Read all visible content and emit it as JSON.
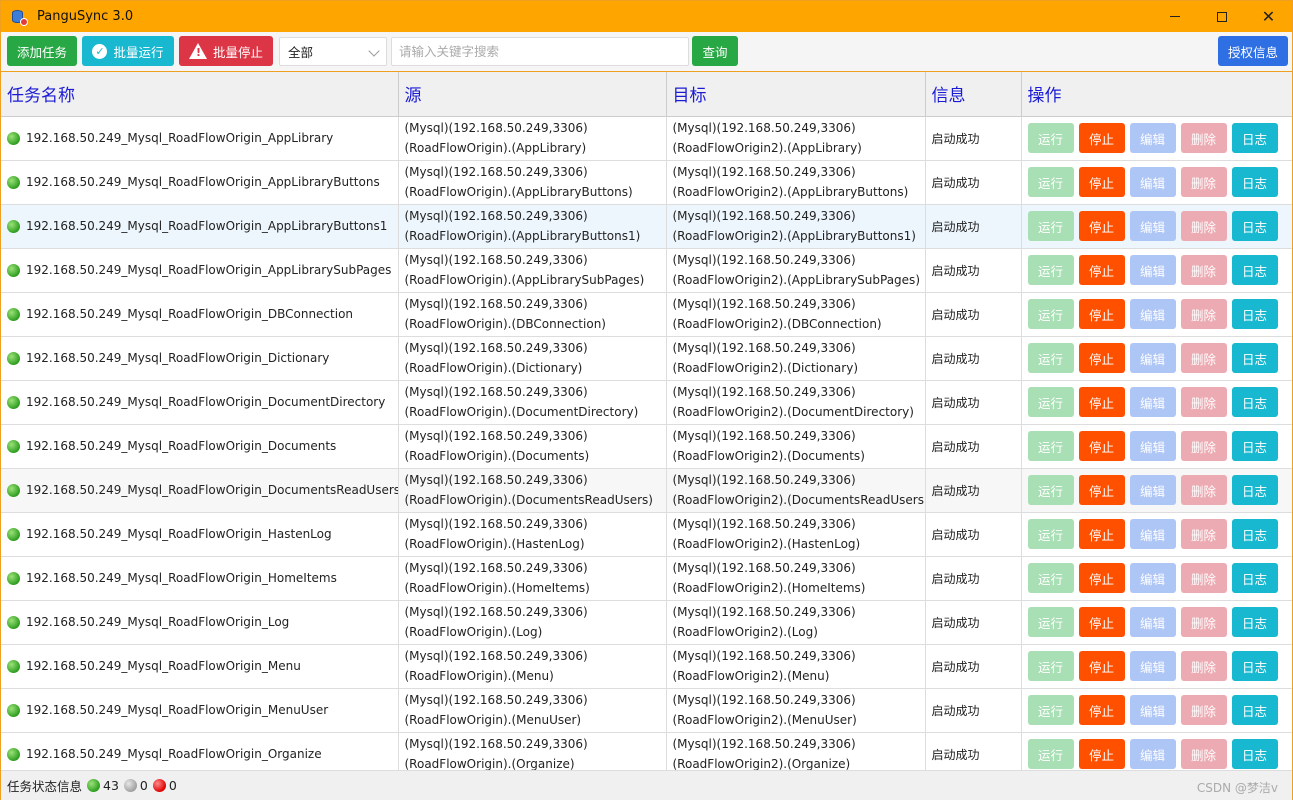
{
  "window": {
    "title": "PanguSync 3.0",
    "controls": {
      "minimize": "—",
      "maximize": "☐",
      "close": "✕"
    }
  },
  "toolbar": {
    "add_task": "添加任务",
    "batch_run": "批量运行",
    "batch_stop": "批量停止",
    "filter_value": "全部",
    "search_placeholder": "请输入关键字搜索",
    "query": "查询",
    "license": "授权信息"
  },
  "table": {
    "headers": {
      "name": "任务名称",
      "source": "源",
      "target": "目标",
      "info": "信息",
      "ops": "操作"
    },
    "op_labels": {
      "run": "运行",
      "stop": "停止",
      "edit": "编辑",
      "delete": "删除",
      "log": "日志"
    },
    "rows": [
      {
        "name": "192.168.50.249_Mysql_RoadFlowOrigin_AppLibrary",
        "src1": "(Mysql)(192.168.50.249,3306)",
        "src2": "(RoadFlowOrigin).(AppLibrary)",
        "dst1": "(Mysql)(192.168.50.249,3306)",
        "dst2": "(RoadFlowOrigin2).(AppLibrary)",
        "info": "启动成功"
      },
      {
        "name": "192.168.50.249_Mysql_RoadFlowOrigin_AppLibraryButtons",
        "src1": "(Mysql)(192.168.50.249,3306)",
        "src2": "(RoadFlowOrigin).(AppLibraryButtons)",
        "dst1": "(Mysql)(192.168.50.249,3306)",
        "dst2": "(RoadFlowOrigin2).(AppLibraryButtons)",
        "info": "启动成功"
      },
      {
        "name": "192.168.50.249_Mysql_RoadFlowOrigin_AppLibraryButtons1",
        "src1": "(Mysql)(192.168.50.249,3306)",
        "src2": "(RoadFlowOrigin).(AppLibraryButtons1)",
        "dst1": "(Mysql)(192.168.50.249,3306)",
        "dst2": "(RoadFlowOrigin2).(AppLibraryButtons1)",
        "info": "启动成功"
      },
      {
        "name": "192.168.50.249_Mysql_RoadFlowOrigin_AppLibrarySubPages",
        "src1": "(Mysql)(192.168.50.249,3306)",
        "src2": "(RoadFlowOrigin).(AppLibrarySubPages)",
        "dst1": "(Mysql)(192.168.50.249,3306)",
        "dst2": "(RoadFlowOrigin2).(AppLibrarySubPages)",
        "info": "启动成功"
      },
      {
        "name": "192.168.50.249_Mysql_RoadFlowOrigin_DBConnection",
        "src1": "(Mysql)(192.168.50.249,3306)",
        "src2": "(RoadFlowOrigin).(DBConnection)",
        "dst1": "(Mysql)(192.168.50.249,3306)",
        "dst2": "(RoadFlowOrigin2).(DBConnection)",
        "info": "启动成功"
      },
      {
        "name": "192.168.50.249_Mysql_RoadFlowOrigin_Dictionary",
        "src1": "(Mysql)(192.168.50.249,3306)",
        "src2": "(RoadFlowOrigin).(Dictionary)",
        "dst1": "(Mysql)(192.168.50.249,3306)",
        "dst2": "(RoadFlowOrigin2).(Dictionary)",
        "info": "启动成功"
      },
      {
        "name": "192.168.50.249_Mysql_RoadFlowOrigin_DocumentDirectory",
        "src1": "(Mysql)(192.168.50.249,3306)",
        "src2": "(RoadFlowOrigin).(DocumentDirectory)",
        "dst1": "(Mysql)(192.168.50.249,3306)",
        "dst2": "(RoadFlowOrigin2).(DocumentDirectory)",
        "info": "启动成功"
      },
      {
        "name": "192.168.50.249_Mysql_RoadFlowOrigin_Documents",
        "src1": "(Mysql)(192.168.50.249,3306)",
        "src2": "(RoadFlowOrigin).(Documents)",
        "dst1": "(Mysql)(192.168.50.249,3306)",
        "dst2": "(RoadFlowOrigin2).(Documents)",
        "info": "启动成功"
      },
      {
        "name": "192.168.50.249_Mysql_RoadFlowOrigin_DocumentsReadUsers",
        "src1": "(Mysql)(192.168.50.249,3306)",
        "src2": "(RoadFlowOrigin).(DocumentsReadUsers)",
        "dst1": "(Mysql)(192.168.50.249,3306)",
        "dst2": "(RoadFlowOrigin2).(DocumentsReadUsers)",
        "info": "启动成功"
      },
      {
        "name": "192.168.50.249_Mysql_RoadFlowOrigin_HastenLog",
        "src1": "(Mysql)(192.168.50.249,3306)",
        "src2": "(RoadFlowOrigin).(HastenLog)",
        "dst1": "(Mysql)(192.168.50.249,3306)",
        "dst2": "(RoadFlowOrigin2).(HastenLog)",
        "info": "启动成功"
      },
      {
        "name": "192.168.50.249_Mysql_RoadFlowOrigin_HomeItems",
        "src1": "(Mysql)(192.168.50.249,3306)",
        "src2": "(RoadFlowOrigin).(HomeItems)",
        "dst1": "(Mysql)(192.168.50.249,3306)",
        "dst2": "(RoadFlowOrigin2).(HomeItems)",
        "info": "启动成功"
      },
      {
        "name": "192.168.50.249_Mysql_RoadFlowOrigin_Log",
        "src1": "(Mysql)(192.168.50.249,3306)",
        "src2": "(RoadFlowOrigin).(Log)",
        "dst1": "(Mysql)(192.168.50.249,3306)",
        "dst2": "(RoadFlowOrigin2).(Log)",
        "info": "启动成功"
      },
      {
        "name": "192.168.50.249_Mysql_RoadFlowOrigin_Menu",
        "src1": "(Mysql)(192.168.50.249,3306)",
        "src2": "(RoadFlowOrigin).(Menu)",
        "dst1": "(Mysql)(192.168.50.249,3306)",
        "dst2": "(RoadFlowOrigin2).(Menu)",
        "info": "启动成功"
      },
      {
        "name": "192.168.50.249_Mysql_RoadFlowOrigin_MenuUser",
        "src1": "(Mysql)(192.168.50.249,3306)",
        "src2": "(RoadFlowOrigin).(MenuUser)",
        "dst1": "(Mysql)(192.168.50.249,3306)",
        "dst2": "(RoadFlowOrigin2).(MenuUser)",
        "info": "启动成功"
      },
      {
        "name": "192.168.50.249_Mysql_RoadFlowOrigin_Organize",
        "src1": "(Mysql)(192.168.50.249,3306)",
        "src2": "(RoadFlowOrigin).(Organize)",
        "dst1": "(Mysql)(192.168.50.249,3306)",
        "dst2": "(RoadFlowOrigin2).(Organize)",
        "info": "启动成功"
      }
    ]
  },
  "status": {
    "label": "任务状态信息",
    "running": "43",
    "idle": "0",
    "error": "0",
    "watermark": "CSDN @梦洁v"
  }
}
